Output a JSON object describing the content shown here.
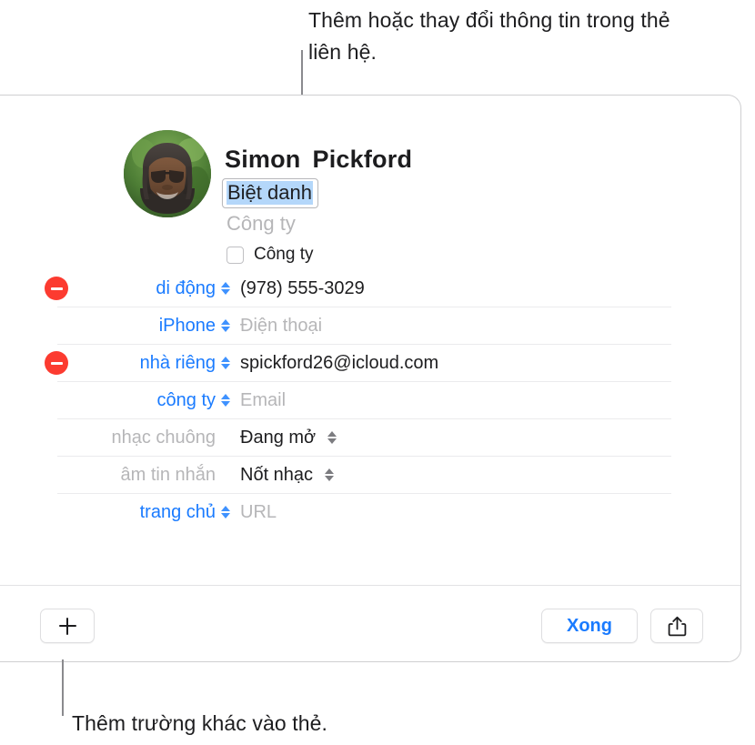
{
  "callouts": {
    "top": "Thêm hoặc thay đổi thông tin trong thẻ liên hệ.",
    "bottom": "Thêm trường khác vào thẻ."
  },
  "card": {
    "header": {
      "first_name": "Simon",
      "last_name": "Pickford",
      "nickname_field_value": "Biệt danh",
      "company_placeholder": "Công ty",
      "company_checkbox_label": "Công ty",
      "company_checkbox_checked": false,
      "avatar_name": "contact-avatar-photo"
    },
    "rows": [
      {
        "id": "mobile-phone",
        "has_remove": true,
        "label": "di động",
        "label_style": "blue",
        "label_stepper": true,
        "stepper_style": "blue",
        "value": "(978) 555-3029",
        "value_style": "dark"
      },
      {
        "id": "iphone-phone",
        "has_remove": false,
        "label": "iPhone",
        "label_style": "blue",
        "label_stepper": true,
        "stepper_style": "blue",
        "value": "Điện thoại",
        "value_style": "placeholder"
      },
      {
        "id": "home-email",
        "has_remove": true,
        "label": "nhà riêng",
        "label_style": "blue",
        "label_stepper": true,
        "stepper_style": "blue",
        "value": "spickford26@icloud.com",
        "value_style": "dark"
      },
      {
        "id": "work-email",
        "has_remove": false,
        "label": "công ty",
        "label_style": "blue",
        "label_stepper": true,
        "stepper_style": "blue",
        "value": "Email",
        "value_style": "placeholder"
      },
      {
        "id": "ringtone",
        "has_remove": false,
        "label": "nhạc chuông",
        "label_style": "gray",
        "label_stepper": false,
        "value": "Đang mở",
        "value_style": "dark",
        "value_stepper": true,
        "stepper_style": "gray"
      },
      {
        "id": "text-tone",
        "has_remove": false,
        "label": "âm tin nhắn",
        "label_style": "gray",
        "label_stepper": false,
        "value": "Nốt nhạc",
        "value_style": "dark",
        "value_stepper": true,
        "stepper_style": "gray"
      },
      {
        "id": "homepage-url",
        "has_remove": false,
        "label": "trang chủ",
        "label_style": "blue",
        "label_stepper": true,
        "stepper_style": "blue",
        "value": "URL",
        "value_style": "placeholder"
      }
    ],
    "toolbar": {
      "add_field_icon": "plus-icon",
      "done_label": "Xong",
      "share_icon": "share-icon"
    }
  },
  "colors": {
    "accent_blue": "#1a7bff",
    "remove_red": "#fc3b30",
    "selection_blue": "#b4d7fa",
    "placeholder_gray": "#b6b6b8",
    "separator": "#ebebed",
    "card_border": "#cfcfd1"
  }
}
